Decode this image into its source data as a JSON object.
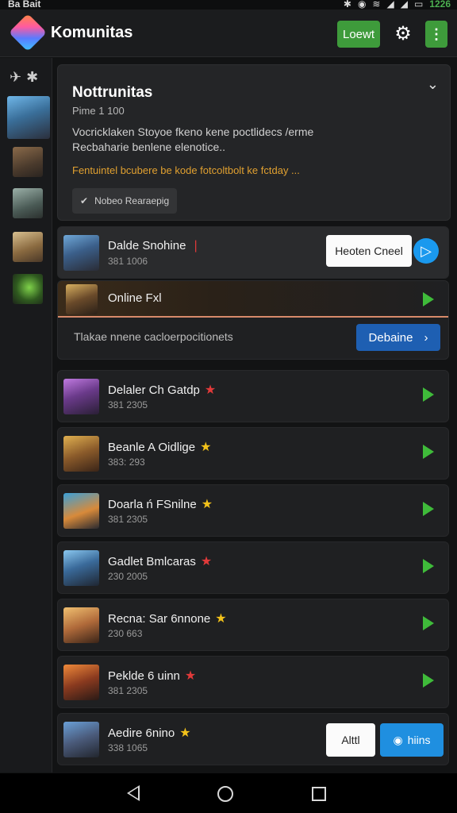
{
  "status_bar": {
    "carrier": "Ba Bait",
    "time": "1226"
  },
  "app_bar": {
    "title": "Komunitas",
    "login_label": "Loewt",
    "more_label": "⋮"
  },
  "colors": {
    "accent_green": "#3e9b3b",
    "play_green": "#3fbb3a",
    "blue": "#1f8fe0",
    "dark_blue": "#1e5fb2",
    "warning": "#e0a030"
  },
  "notification": {
    "title": "Nottrunitas",
    "subtitle": "Pime 1 100",
    "body": "Vocricklaken Stoyoe fkeno kene poctlidecs /erme Recbaharie benlene elenotice..",
    "warning": "Fentuintel bcubere be kode fotcoltbolt ke fctday ...",
    "chip_label": "Nobeo Rearaepig"
  },
  "featured": {
    "title": "Dalde Snohine",
    "sub": "381 1006",
    "button_label": "Heoten Cneel"
  },
  "expanded": {
    "title": "Online Fxl",
    "message": "Tlakae nnene cacloerpocitionets",
    "button_label": "Debaine"
  },
  "games": [
    {
      "title": "Delaler Ch Gatdp",
      "sub": "381 2305",
      "star": "red"
    },
    {
      "title": "Beanle A Oidlige",
      "sub": "383: 293",
      "star": "yellow"
    },
    {
      "title": "Doarla ń FSnilne",
      "sub": "381 2305",
      "star": "yellow"
    },
    {
      "title": "Gadlet Bmlcaras",
      "sub": "230 2005",
      "star": "red"
    },
    {
      "title": "Recna: Sar 6nnone",
      "sub": "230 663",
      "star": "yellow"
    },
    {
      "title": "Peklde 6 uinn",
      "sub": "381 2305",
      "star": "red"
    }
  ],
  "last_row": {
    "title": "Aedire 6nino",
    "sub": "338 1065",
    "button_white": "Alttl",
    "button_blue": "hiins"
  }
}
